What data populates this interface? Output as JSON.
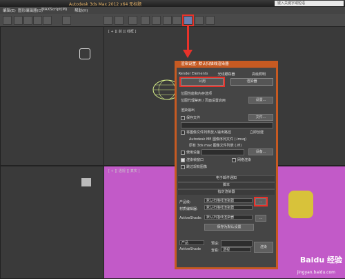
{
  "window": {
    "title": "Autodesk 3ds Max  2012 x64    无标题",
    "search_placeholder": "键入关键字或短语"
  },
  "menu": [
    "编辑(E)",
    "图形编辑器(D)",
    "MAXScript(M)",
    "帮助(H)"
  ],
  "viewports": {
    "top_right": "[ + ][ 前 ][ 线框 ]",
    "bottom_right": "[ + ][ 透视 ][ 真实 ]"
  },
  "dialog": {
    "title": "渲染设置: 默认扫描线渲染器",
    "tabs_row1": [
      "Render Elements",
      "光线跟踪器",
      "高级照明"
    ],
    "tabs_row2": [
      "公用",
      "渲染器"
    ],
    "lines": {
      "proxy_section": "位图性能和内存选项",
      "proxy_text": "位图代理禁用 / 页面设置启用",
      "setup_btn": "设置...",
      "output_section": "渲染输出",
      "save_file": "保存文件",
      "file_btn": "文件...",
      "queue_label": "将图像文件列表放入输出路径",
      "create_now": "立即创建",
      "autodesk_list": "Autodesk ME 图像序列文件 (.imsq)",
      "legacy_list": "原有 3ds max 图像文件列表 (.ifl)",
      "device": "使用设备",
      "device_btn": "设备...",
      "frame_window": "渲染帧窗口",
      "net_render": "网络渲染",
      "skip_existing": "跳过现有图像"
    },
    "rollouts": [
      "电子邮件通知",
      "脚本",
      "指定渲染器"
    ],
    "assign": {
      "production_label": "产品级:",
      "production_value": "默认扫描线渲染器",
      "material_label": "材质编辑器:",
      "material_value": "默认扫描线渲染器",
      "activeshade_label": "ActiveShade:",
      "activeshade_value": "默认扫描线渲染器",
      "save_default": "保存为默认设置",
      "more_btn": "..."
    },
    "footer": {
      "mode_product": "产品",
      "mode_activeshade": "ActiveShade",
      "preset_label": "预设:",
      "view_label": "查看:",
      "view_value": "透视",
      "render_btn": "渲染"
    }
  },
  "watermark": {
    "brand": "Baidu 经验",
    "url": "jingyan.baidu.com"
  }
}
